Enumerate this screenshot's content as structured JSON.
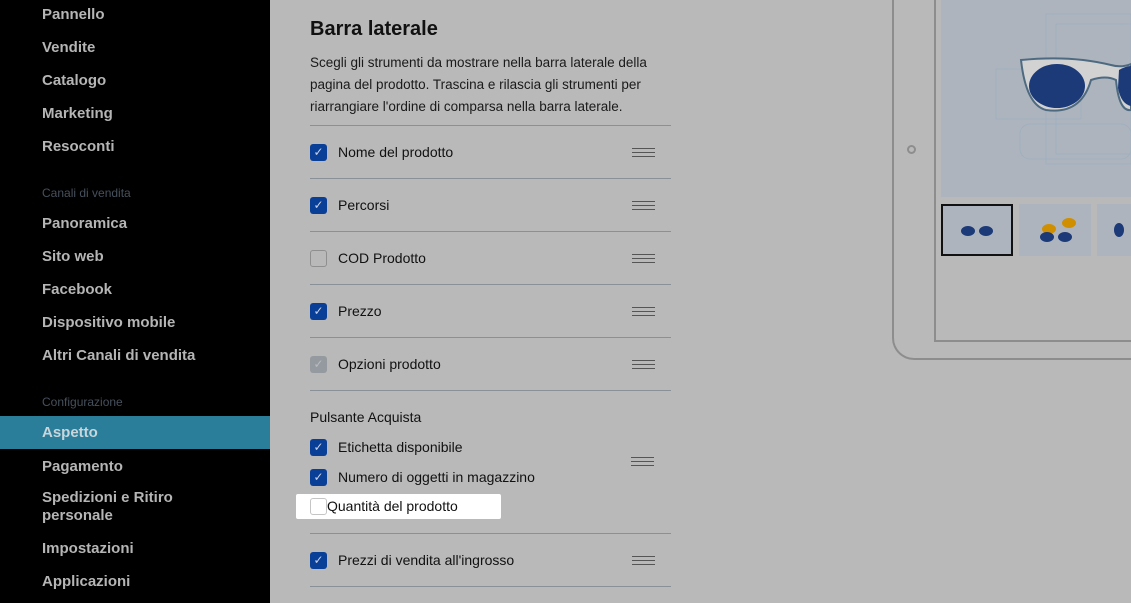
{
  "sidebar": {
    "items_top": [
      "Pannello",
      "Vendite",
      "Catalogo",
      "Marketing",
      "Resoconti"
    ],
    "section_channels": "Canali di vendita",
    "items_channels": [
      "Panoramica",
      "Sito web",
      "Facebook",
      "Dispositivo mobile",
      "Altri Canali di vendita"
    ],
    "section_config": "Configurazione",
    "items_config": [
      "Aspetto",
      "Pagamento",
      "Spedizioni e Ritiro personale",
      "Impostazioni",
      "Applicazioni"
    ],
    "active": "Aspetto"
  },
  "main": {
    "title": "Barra laterale",
    "description": "Scegli gli strumenti da mostrare nella barra laterale della pagina del prodotto. Trascina e rilascia gli strumenti per riarrangiare l'ordine di comparsa nella barra laterale.",
    "rows": [
      {
        "label": "Nome del prodotto",
        "checked": true
      },
      {
        "label": "Percorsi",
        "checked": true
      },
      {
        "label": "COD Prodotto",
        "checked": false
      },
      {
        "label": "Prezzo",
        "checked": true
      },
      {
        "label": "Opzioni prodotto",
        "checked": true,
        "disabled": true
      }
    ],
    "group_title": "Pulsante Acquista",
    "group_rows": [
      {
        "label": "Etichetta disponibile",
        "checked": true
      },
      {
        "label": "Numero di oggetti in magazzino",
        "checked": true
      },
      {
        "label": "Quantità del prodotto",
        "checked": false,
        "highlighted": true
      }
    ],
    "last_row": {
      "label": "Prezzi di vendita all'ingrosso",
      "checked": true
    }
  },
  "colors": {
    "active_nav": "#2a7e9a",
    "checkbox": "#0a3f98",
    "lens": "#1c3a78",
    "accent_lens": "#d08f00"
  }
}
